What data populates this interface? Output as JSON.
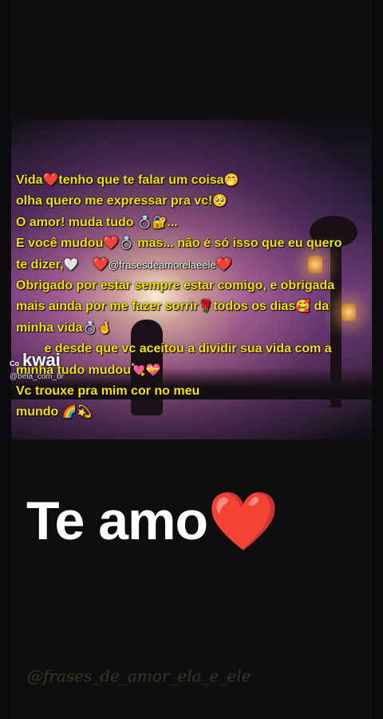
{
  "poem": {
    "lines": [
      {
        "a": "Vida",
        "i1": "❤️",
        "b": "tenho que te falar um coisa",
        "i2": "🤭"
      },
      {
        "a": "olha quero me expressar pra vc!",
        "i1": "🥺"
      },
      {
        "a": "O amor! muda tudo ",
        "i1": "💍",
        "i2": "🔐",
        "b": "..."
      },
      {
        "a": "E você mudou",
        "i1": "❤️",
        "i2": "💍",
        "b": " mas... não é só isso que eu quero"
      },
      {
        "a": "te dizer,",
        "i1": "🤍",
        "i2": "❤️",
        "handle": "@frasesdeamorelaeele",
        "i3": "❤️"
      },
      {
        "a": "Obrigado por estar sempre estar comigo, e obrigada"
      },
      {
        "a": "mais ainda por me fazer sorrir",
        "i1": "🌹",
        "b": "todos os dias",
        "i2": "🥰",
        "c": " da"
      },
      {
        "a": "minha vida",
        "i1": "💍",
        "i2": "🤞"
      },
      {
        "a": "e desde que vc aceitou a dividir sua vida com a"
      },
      {
        "a": "minha tudo mudou",
        "i1": "💘",
        "i2": "💝"
      },
      {
        "a": "Vc trouxe pra mim cor no meu"
      },
      {
        "a": "mundo ",
        "i1": "🌈",
        "i2": "💫"
      }
    ]
  },
  "kwai": {
    "logo": "kwai",
    "prefix": "Co",
    "user": "@bela_com_br"
  },
  "title": {
    "text": "Te amo",
    "heart": "❤️"
  },
  "watermark": "@frases_de_amor_ela_e_ele",
  "colors": {
    "poem_text": "#f5e400",
    "heart": "#e3202a",
    "background": "#0f0f12"
  }
}
